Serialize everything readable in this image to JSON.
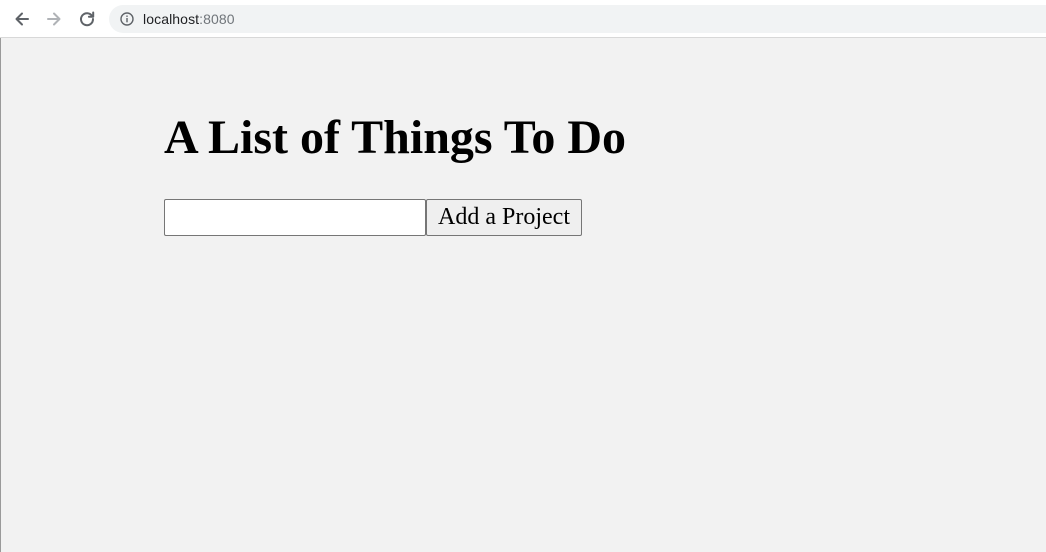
{
  "browser": {
    "url_host": "localhost",
    "url_port": ":8080"
  },
  "page": {
    "title": "A List of Things To Do",
    "input": {
      "value": "",
      "placeholder": ""
    },
    "add_button_label": "Add a Project"
  }
}
